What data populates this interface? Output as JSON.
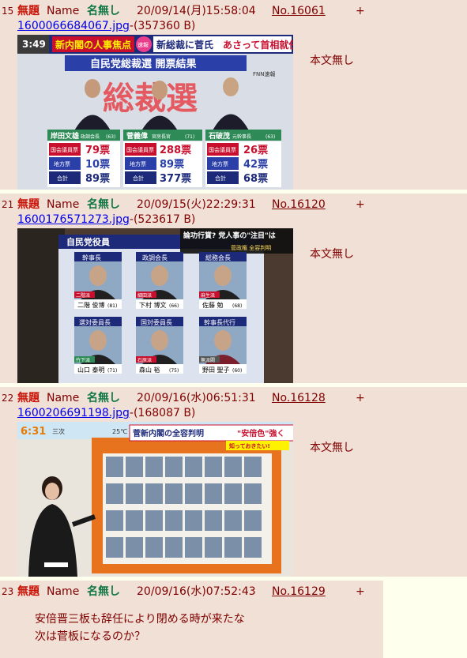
{
  "posts": [
    {
      "index": "15",
      "subject": "無題",
      "name_label": "Name",
      "name": "名無し",
      "datetime": "20/09/14(月)15:58:04",
      "number": "No.16061",
      "plus": "+",
      "file_name": "1600066684067.jpg",
      "file_size": "-(357360 B)",
      "body": "本文無し",
      "image": {
        "time": "3:49",
        "tag1": "新内閣の人事焦点",
        "tag2": "新総裁に菅氏",
        "tag3": "あさって首相就任",
        "badge": "速報",
        "network": "FNN速報",
        "banner": "自民党総裁選 開票結果",
        "big": "総裁選",
        "candidates": [
          {
            "name": "岸田文雄",
            "role": "政調会長",
            "age": "(63)",
            "r1": "国会議員票",
            "v1": "79票",
            "r2": "地方票",
            "v2": "10票",
            "r3": "合計",
            "v3": "89票"
          },
          {
            "name": "菅義偉",
            "role": "官房長官",
            "age": "(71)",
            "r1": "国会議員票",
            "v1": "288票",
            "r2": "地方票",
            "v2": "89票",
            "r3": "合計",
            "v3": "377票"
          },
          {
            "name": "石破茂",
            "role": "元幹事長",
            "age": "(63)",
            "r1": "国会議員票",
            "v1": "26票",
            "r2": "地方票",
            "v2": "42票",
            "r3": "合計",
            "v3": "68票"
          }
        ]
      }
    },
    {
      "index": "21",
      "subject": "無題",
      "name_label": "Name",
      "name": "名無し",
      "datetime": "20/09/15(火)22:29:31",
      "number": "No.16120",
      "plus": "+",
      "file_name": "1600176571273.jpg",
      "file_size": "-(523617 B)",
      "body": "本文無し",
      "image": {
        "board_title": "自民党役員",
        "caption": "論功行賞? 党人事の\"注目\"は",
        "caption_sub": "菅政権 全容判明",
        "officers": [
          {
            "role": "幹事長",
            "tag": "二階派",
            "name": "二階 俊博",
            "age": "(81)"
          },
          {
            "role": "政調会長",
            "tag": "細田派",
            "name": "下村 博文",
            "age": "(66)"
          },
          {
            "role": "総務会長",
            "tag": "麻生派",
            "name": "佐藤 勉",
            "age": "(68)"
          },
          {
            "role": "選対委員長",
            "tag": "竹下派",
            "name": "山口 泰明",
            "age": "(71)"
          },
          {
            "role": "国対委員長",
            "tag": "石原派",
            "name": "森山 裕",
            "age": "(75)"
          },
          {
            "role": "幹事長代行",
            "tag": "無派閥",
            "name": "野田 聖子",
            "age": "(60)"
          }
        ]
      }
    },
    {
      "index": "22",
      "subject": "無題",
      "name_label": "Name",
      "name": "名無し",
      "datetime": "20/09/16(水)06:51:31",
      "number": "No.16128",
      "plus": "+",
      "file_name": "1600206691198.jpg",
      "file_size": "-(168087 B)",
      "body": "本文無し",
      "image": {
        "time": "6:31",
        "temp": "25℃",
        "location": "三次",
        "headline1": "菅新内閣の全容判明",
        "headline2": "\"安倍色\"強く",
        "note": "知っておきたい!"
      }
    },
    {
      "index": "23",
      "subject": "無題",
      "name_label": "Name",
      "name": "名無し",
      "datetime": "20/09/16(水)07:52:43",
      "number": "No.16129",
      "plus": "+",
      "body_lines": [
        "安倍晋三板も辞任により閉める時が来たな",
        "次は菅板になるのか？"
      ]
    }
  ],
  "colors": {
    "post_bg": "#f0e0d6",
    "page_bg": "#ffffee",
    "subject": "#cc1105",
    "name": "#117743",
    "link": "#0000ee"
  }
}
